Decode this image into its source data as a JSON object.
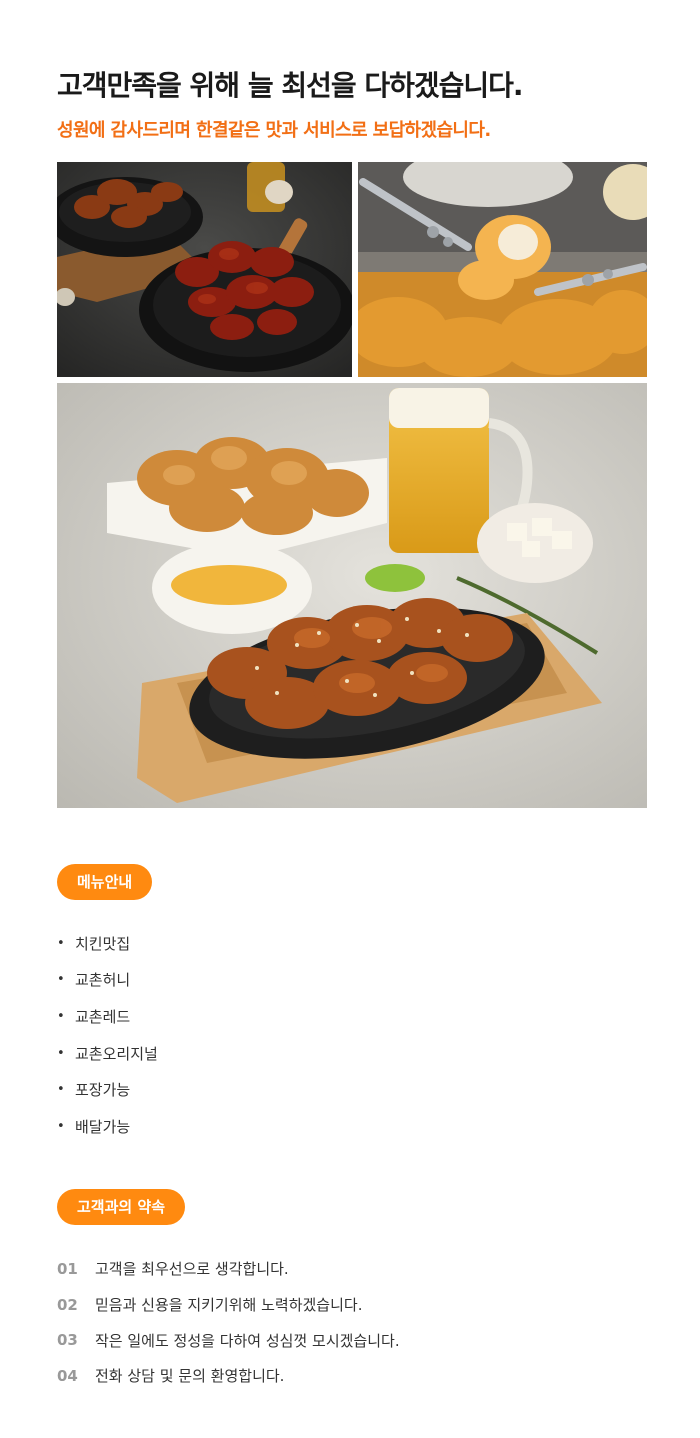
{
  "header": {
    "headline": "고객만족을 위해 늘 최선을 다하겠습니다.",
    "subline": "성원에 감사드리며 한결같은 맛과 서비스로 보답하겠습니다."
  },
  "colors": {
    "accent": "#f26f15",
    "pill": "#ff8a10"
  },
  "photos": [
    {
      "icon": "chicken-plates-photo"
    },
    {
      "icon": "tongs-fried-chicken-photo"
    },
    {
      "icon": "chicken-beer-spread-photo"
    }
  ],
  "menu": {
    "title": "메뉴안내",
    "bullet": "•",
    "items": [
      "치킨맛집",
      "교촌허니",
      "교촌레드",
      "교촌오리지널",
      "포장가능",
      "배달가능"
    ]
  },
  "promise": {
    "title": "고객과의 약속",
    "items": [
      {
        "num": "01",
        "text": "고객을 최우선으로 생각합니다."
      },
      {
        "num": "02",
        "text": "믿음과 신용을 지키기위해 노력하겠습니다."
      },
      {
        "num": "03",
        "text": "작은 일에도 정성을 다하여 성심껏 모시겠습니다."
      },
      {
        "num": "04",
        "text": "전화 상담 및 문의 환영합니다."
      }
    ]
  }
}
